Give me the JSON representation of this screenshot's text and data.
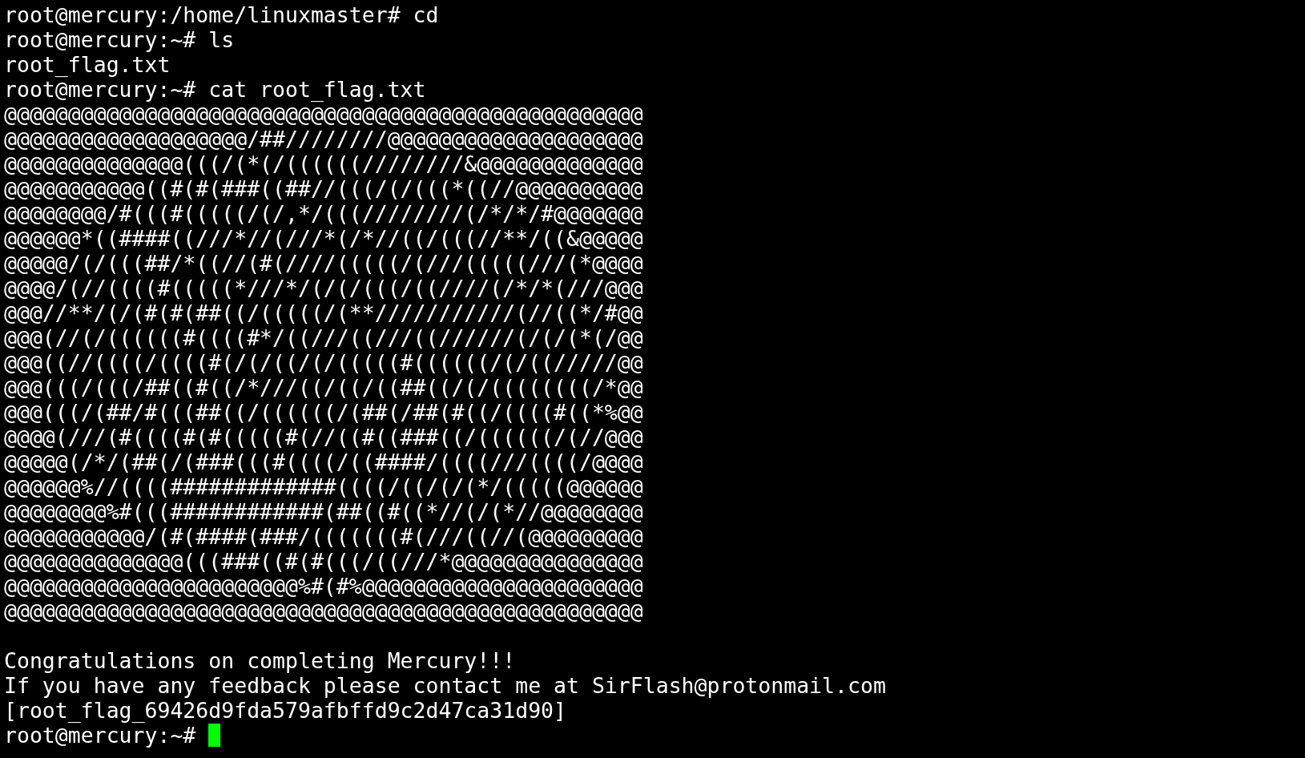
{
  "terminal": {
    "history": [
      {
        "prompt": "root@mercury:/home/linuxmaster#",
        "command": "cd"
      },
      {
        "prompt": "root@mercury:~#",
        "command": "ls",
        "output": [
          "root_flag.txt"
        ]
      },
      {
        "prompt": "root@mercury:~#",
        "command": "cat root_flag.txt"
      }
    ],
    "art": [
      "@@@@@@@@@@@@@@@@@@@@@@@@@@@@@@@@@@@@@@@@@@@@@@@@@@",
      "@@@@@@@@@@@@@@@@@@@/##////////@@@@@@@@@@@@@@@@@@@@",
      "@@@@@@@@@@@@@@(((/(*(/((((((////////&@@@@@@@@@@@@@",
      "@@@@@@@@@@@((#(#(###((##//(((/(/(((*((//@@@@@@@@@@",
      "@@@@@@@@/#(((#(((((/(/,*/(((////////(/*/*/#@@@@@@@",
      "@@@@@@*((####((///*//(///*(/*//((/(((//**/((&@@@@@",
      "@@@@@/(/(((##/*((//(#(////(((((/(///(((((///(*@@@@",
      "@@@@/(//((((#(((((*///*/(/(/(((/((////(/*/*(///@@@",
      "@@@//**/(/(#(#(##((/(((((/(**///////////(//((*/#@@",
      "@@@(//(/((((((#((((#*/((///((///((//////(/(/(*(/@@",
      "@@@((//((((/((((#(/(/((/(/(((((#((((((/(/((/////@@",
      "@@@(((/(((/##((#((/*///((/((/((##((/(/((((((((/*@@",
      "@@@(((/(##/#(((##((/((((((/(##(/##(#((/((((#((*%@@",
      "@@@@(///(#((((#(#(((((#(//((#((###((/((((((/(//@@@",
      "@@@@@(/*/(##(/(###(((#((((/((####/((((///((((/@@@@",
      "@@@@@@%//((((#############((((/((/(/(*/(((((@@@@@@",
      "@@@@@@@@%#(((############(##((#((*//(/(*//@@@@@@@@",
      "@@@@@@@@@@@/(#(####(###/(((((((#(///((//(@@@@@@@@@",
      "@@@@@@@@@@@@@@(((###((#(#(((/((///*@@@@@@@@@@@@@@@",
      "@@@@@@@@@@@@@@@@@@@@@@@%#(#%@@@@@@@@@@@@@@@@@@@@@@",
      "@@@@@@@@@@@@@@@@@@@@@@@@@@@@@@@@@@@@@@@@@@@@@@@@@@"
    ],
    "message": [
      "Congratulations on completing Mercury!!!",
      "If you have any feedback please contact me at SirFlash@protonmail.com",
      "[root_flag_69426d9fda579afbffd9c2d47ca31d90]"
    ],
    "prompt": {
      "text": "root@mercury:~#",
      "cursor": true
    }
  }
}
